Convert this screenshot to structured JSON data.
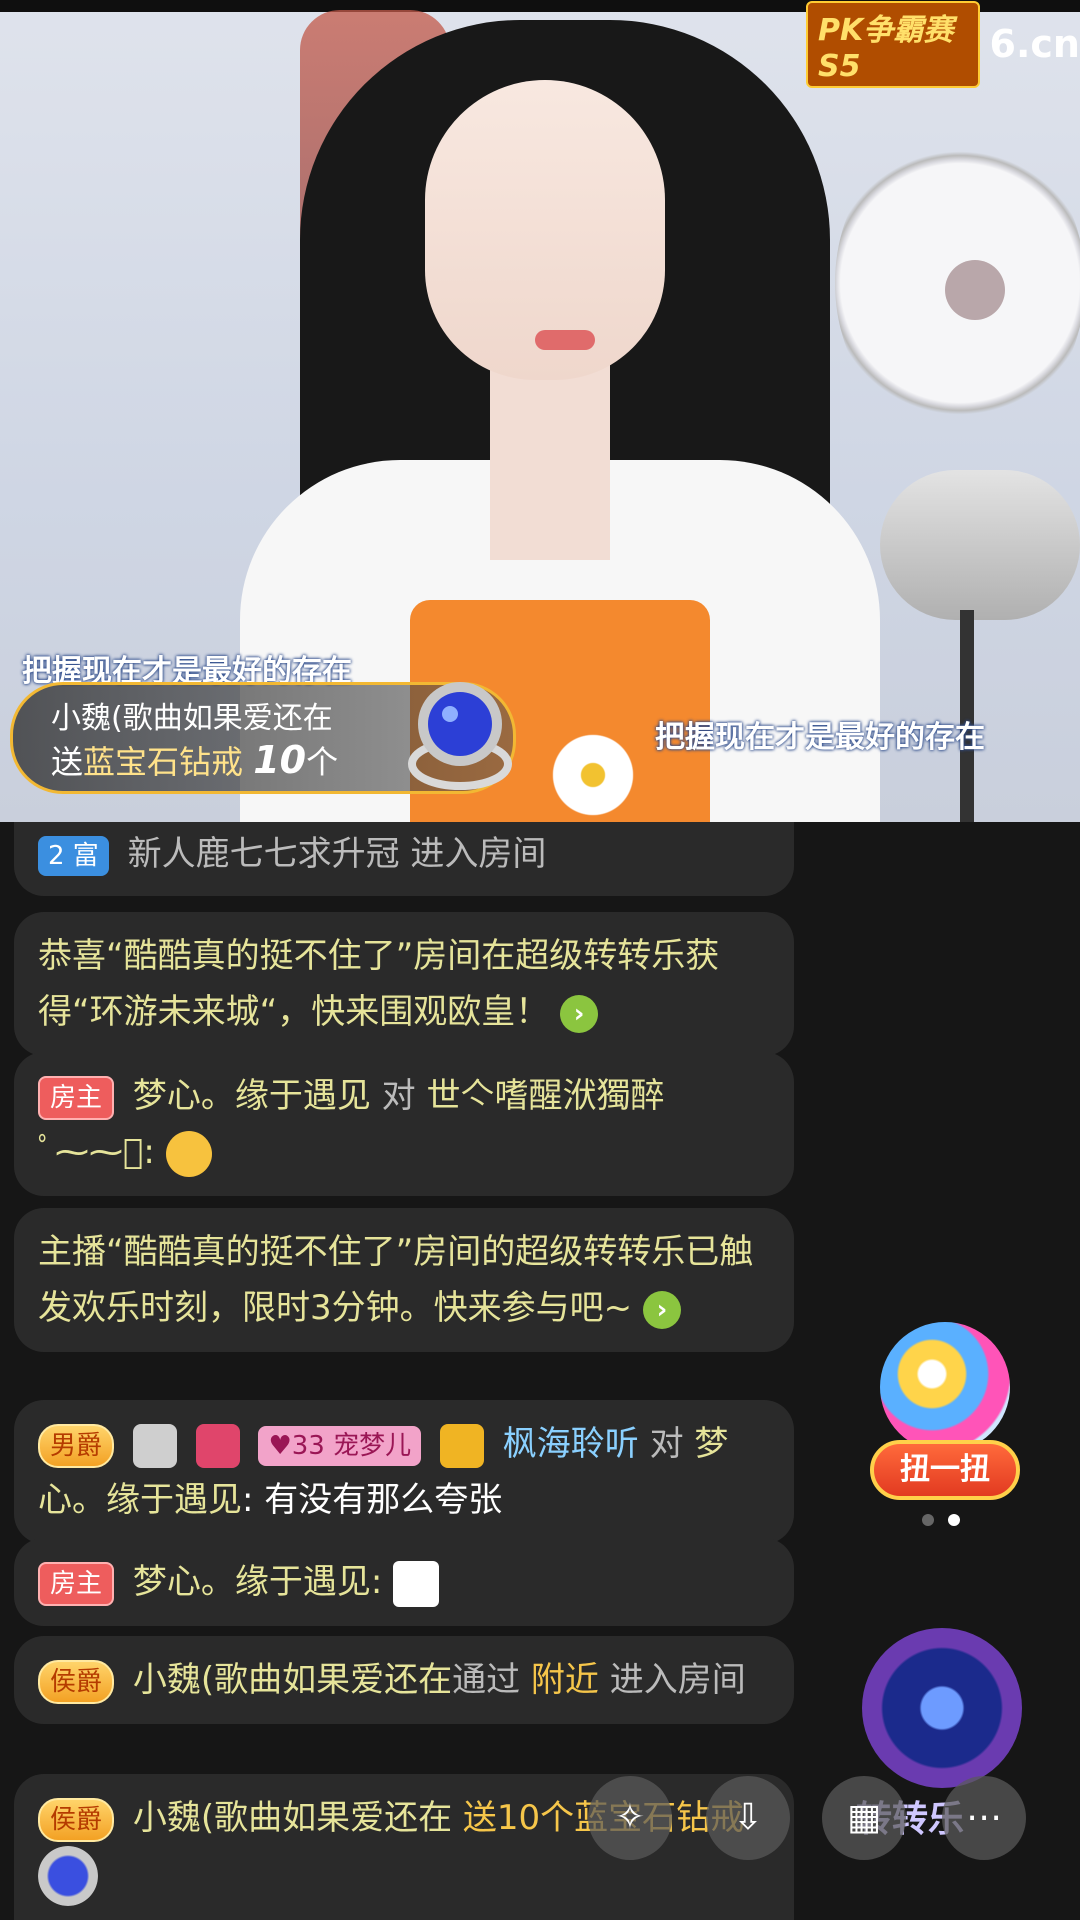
{
  "video": {
    "logo_pk": "PK争霸赛S5",
    "logo_site": "6.cn",
    "lyric_left": "把握现在才是最好的存在",
    "lyric_right": "把握现在才是最好的存在",
    "gift_banner": {
      "sender": "小魏(歌曲如果爱还在",
      "send_word": "送",
      "gift_name": "蓝宝石钻戒",
      "count": "10",
      "unit": "个"
    }
  },
  "chat": [
    {
      "badge": "2 富",
      "text": "新人鹿七七求升冠 进入房间"
    },
    {
      "text": "恭喜“酷酷真的挺不住了”房间在超级转转乐获得“环游未来城“，快来围观欧皇！"
    },
    {
      "badge": "房主",
      "name": "梦心。缘于遇见",
      "mid": " 对 ",
      "target": "世亽嗜醒洑獨醉",
      "tail": "ﾟ⁓⁓ﾟ:"
    },
    {
      "text": "主播“酷酷真的挺不住了”房间的超级转转乐已触发欢乐时刻，限时3分钟。快来参与吧~"
    },
    {
      "badge": "男爵",
      "badge2": "宠梦儿",
      "level": "33",
      "name": "枫海聆听",
      "mid": " 对 ",
      "target": "梦心。缘于遇见",
      "content": ": 有没有那么夸张"
    },
    {
      "badge": "房主",
      "name": "梦心。缘于遇见:"
    },
    {
      "badge": "侯爵",
      "name": "小魏(歌曲如果爱还在",
      "via": "通过 ",
      "place": "附近",
      "tail": " 进入房间"
    },
    {
      "badge": "侯爵",
      "name": "小魏(歌曲如果爱还在",
      "gift": " 送10个蓝宝石钻戒"
    }
  ],
  "widgets": {
    "gacha_button": "扭一扭",
    "wheel_label": "转转乐"
  },
  "bottom_bar": [
    "share-icon",
    "download-icon",
    "grid-icon",
    "more-icon"
  ],
  "colors": {
    "badge_host": "#ee5d5d",
    "chat_bg": "#2a2a2a",
    "highlight": "#e6e49a",
    "gold": "#f6c64a"
  }
}
